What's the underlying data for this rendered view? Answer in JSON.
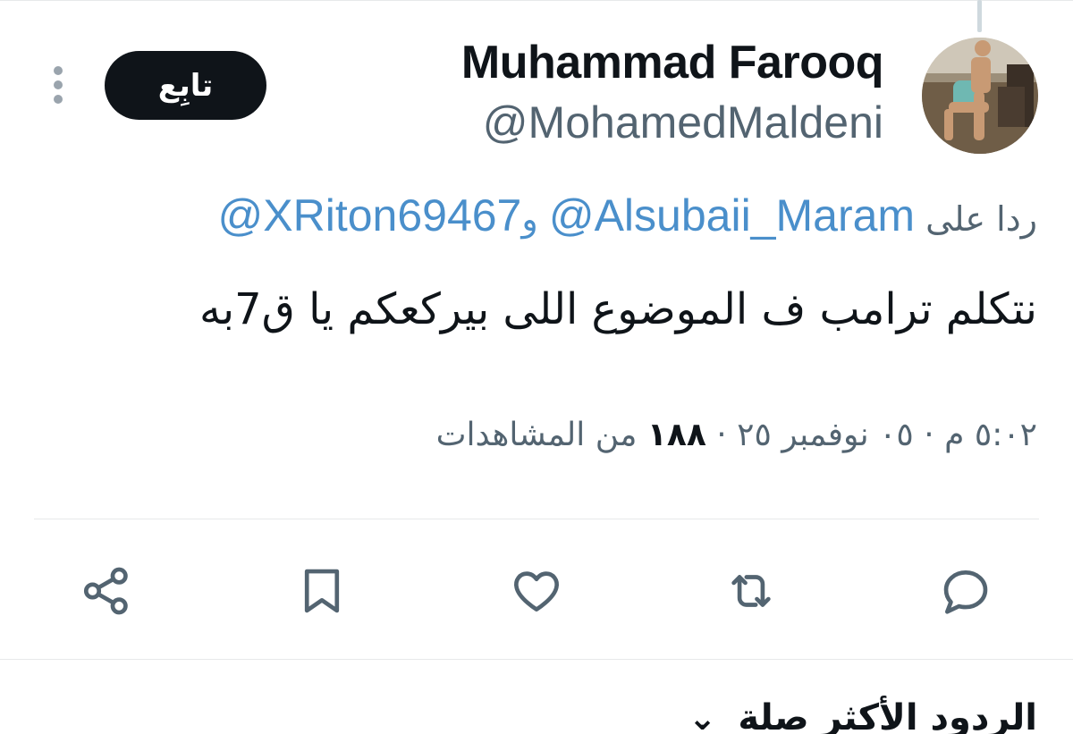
{
  "tweet": {
    "author_name": "Muhammad Farooq",
    "author_handle": "@MohamedMaldeni",
    "follow_label": "تابِع",
    "reply_prefix": "ردا على",
    "reply_mention_1": "@Alsubaii_Maram",
    "reply_conjunction": "و",
    "reply_mention_2": "@XRiton69467",
    "text": "نتكلم ترامب ف الموضوع اللى بيركعكم يا ق7به",
    "time": "٥:٠٢ م",
    "separator": "·",
    "date": "٠٥ نوفمبر ٢٥",
    "views_count": "١٨٨",
    "views_label": "من المشاهدات"
  },
  "actions": {
    "reply_icon": "reply-icon",
    "retweet_icon": "retweet-icon",
    "like_icon": "heart-icon",
    "bookmark_icon": "bookmark-icon",
    "share_icon": "share-icon"
  },
  "replies_sort": {
    "label": "الردود الأكثر صلة",
    "chevron": "⌄"
  },
  "colors": {
    "text": "#0f1419",
    "secondary": "#536471",
    "mention": "#4a8fcb",
    "follow_bg": "#0f1419",
    "divider": "#e7e9ea"
  }
}
